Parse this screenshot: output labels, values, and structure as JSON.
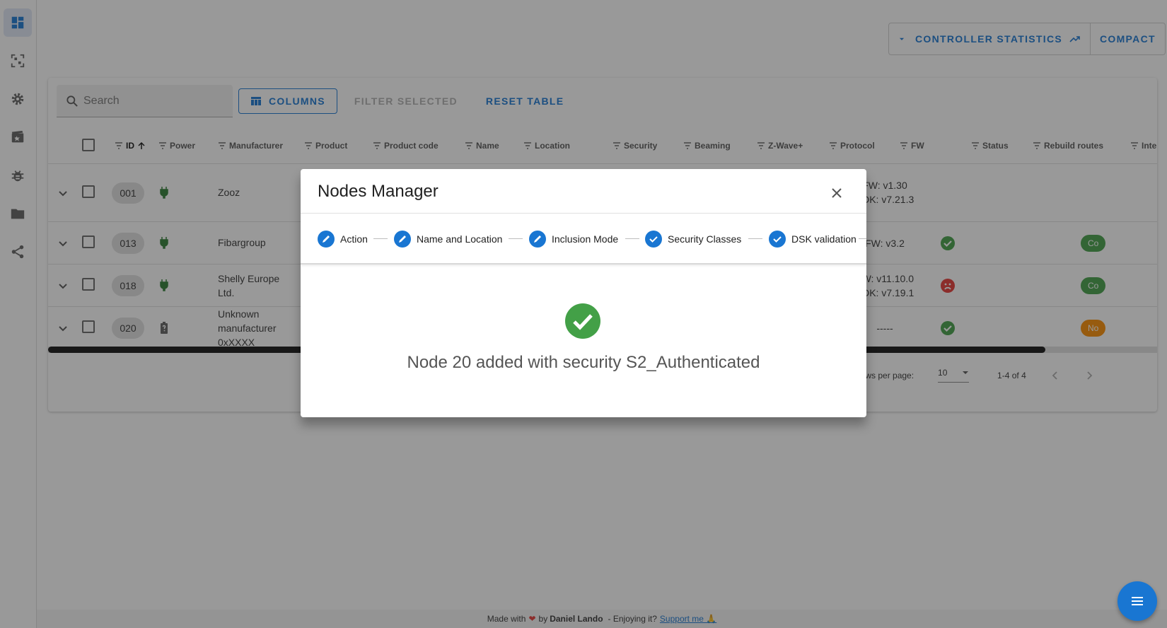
{
  "app": {
    "colors": {
      "primary": "#1976d2",
      "success": "#43a047",
      "error": "#e53935",
      "warning": "#fb8c00",
      "power_green": "#2e7d32"
    }
  },
  "sidebar": {
    "items": [
      {
        "icon": "dashboard-icon",
        "active": true
      },
      {
        "icon": "qr-scan-icon"
      },
      {
        "icon": "gear-icon"
      },
      {
        "icon": "scenes-icon"
      },
      {
        "icon": "bug-icon"
      },
      {
        "icon": "folder-icon"
      },
      {
        "icon": "share-icon"
      }
    ]
  },
  "header": {
    "controller_stats_label": "Controller statistics",
    "compact_label": "Compact"
  },
  "toolbar": {
    "search_placeholder": "Search",
    "columns_label": "Columns",
    "filter_selected_label": "Filter selected",
    "reset_table_label": "Reset table"
  },
  "table": {
    "columns": [
      "ID",
      "Power",
      "Manufacturer",
      "Product",
      "Product code",
      "Name",
      "Location",
      "Security",
      "Beaming",
      "Z-Wave+",
      "Protocol",
      "FW",
      "Status",
      "Rebuild routes",
      "Inte"
    ],
    "rows": [
      {
        "id": "001",
        "power": "mains",
        "manufacturer": "Zooz",
        "fw1": "FW: v1.30",
        "fw2": "SDK: v7.21.3",
        "status": "",
        "badge": ""
      },
      {
        "id": "013",
        "power": "mains",
        "manufacturer": "Fibargroup",
        "fw1": "FW: v3.2",
        "fw2": "",
        "status": "alive",
        "badge": "Co"
      },
      {
        "id": "018",
        "power": "mains",
        "manufacturer": "Shelly Europe Ltd.",
        "fw1": "FW: v11.10.0",
        "fw2": "SDK: v7.19.1",
        "status": "dead",
        "badge": "Co"
      },
      {
        "id": "020",
        "power": "battery-unknown",
        "manufacturer": "Unknown manufacturer 0xXXXX",
        "fw1": "-----",
        "fw2": "",
        "status": "alive",
        "badge": "No"
      }
    ],
    "pagination": {
      "rows_per_page_label": "Rows per page:",
      "rows_per_page": "10",
      "range": "1-4 of 4"
    }
  },
  "dialog": {
    "title": "Nodes Manager",
    "steps": [
      {
        "label": "Action",
        "icon": "pencil-icon"
      },
      {
        "label": "Name and Location",
        "icon": "pencil-icon"
      },
      {
        "label": "Inclusion Mode",
        "icon": "pencil-icon"
      },
      {
        "label": "Security Classes",
        "icon": "check-icon"
      },
      {
        "label": "DSK validation",
        "icon": "check-icon"
      }
    ],
    "message": "Node 20 added with security S2_Authenticated"
  },
  "footer": {
    "made_with": "Made with",
    "by": "by",
    "author": "Daniel Lando",
    "enjoying": "- Enjoying it?",
    "support": "Support me 🙏"
  }
}
